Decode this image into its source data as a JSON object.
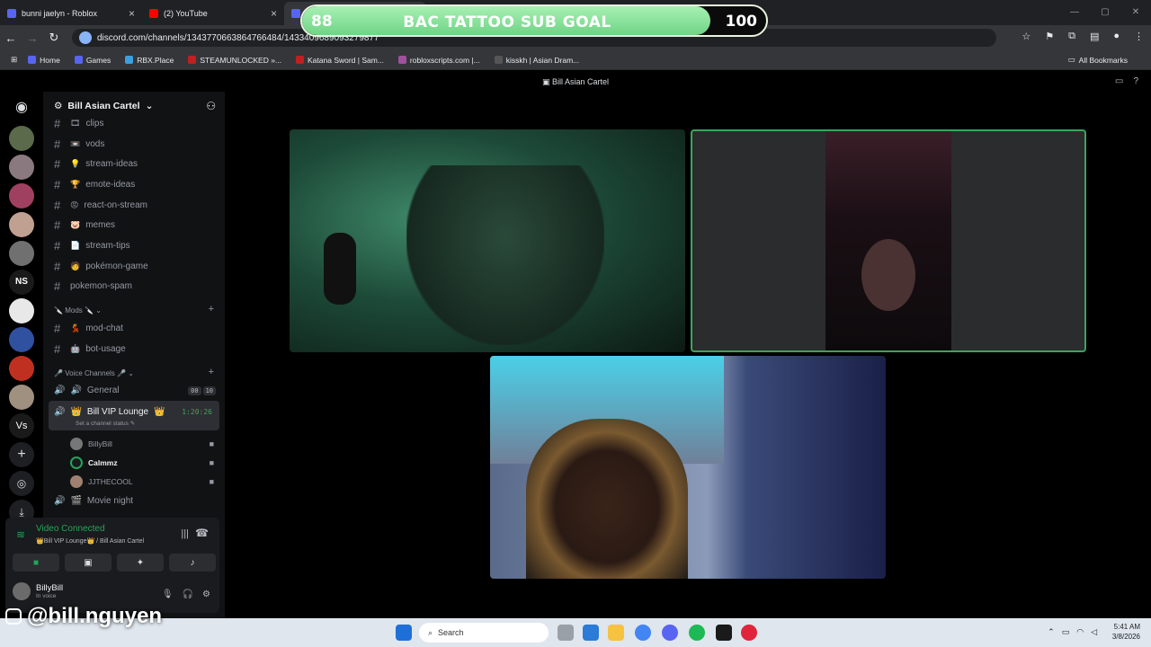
{
  "browser": {
    "tabs": [
      {
        "title": "bunni jaelyn - Roblox",
        "color": "#5865f2"
      },
      {
        "title": "(2) YouTube",
        "color": "#ff0000"
      },
      {
        "title": "",
        "color": "#5865f2"
      }
    ],
    "url": "discord.com/channels/1343770663864766484/1433409689093279877",
    "bookmarks": [
      "Home",
      "Games",
      "RBX.Place",
      "STEAMUNLOCKED »...",
      "Katana Sword | Sam...",
      "robloxscripts.com |...",
      "kisskh | Asian Dram..."
    ],
    "all_bookmarks": "All Bookmarks"
  },
  "overlay": {
    "goal_title": "BAC TATTOO SUB GOAL",
    "current": "88",
    "target": "100",
    "progress_fraction": 0.88,
    "watermark": "@bill.nguyen"
  },
  "discord": {
    "window_title": "Bill Asian Cartel",
    "server_name": "Bill Asian Cartel",
    "channels": [
      {
        "emoji": "🎞",
        "name": "clips"
      },
      {
        "emoji": "📼",
        "name": "vods"
      },
      {
        "emoji": "💡",
        "name": "stream-ideas"
      },
      {
        "emoji": "🏆",
        "name": "emote-ideas"
      },
      {
        "emoji": "😡",
        "name": "react-on-stream"
      },
      {
        "emoji": "🐷",
        "name": "memes"
      },
      {
        "emoji": "📄",
        "name": "stream-tips"
      },
      {
        "emoji": "🧑",
        "name": "pokémon-game"
      },
      {
        "emoji": "",
        "name": "pokemon-spam"
      }
    ],
    "mods_category": "Mods",
    "mod_channels": [
      {
        "emoji": "💃",
        "name": "mod-chat"
      },
      {
        "emoji": "🤖",
        "name": "bot-usage"
      }
    ],
    "voice_category": "Voice Channels",
    "voice": {
      "general": "General",
      "general_badges": [
        "00",
        "10"
      ],
      "lounge": "Bill VIP Lounge",
      "lounge_timer": "1:20:26",
      "lounge_status": "Set a channel status",
      "members": [
        "BillyBill",
        "Calmmz",
        "JJTHECOOL"
      ],
      "movie": "Movie night"
    },
    "panel": {
      "connected": "Video Connected",
      "location": "👑Bill VIP Lounge👑 / Bill Asian Cartel",
      "user": "BillyBill",
      "user_status": "In voice"
    }
  },
  "taskbar": {
    "search": "Search",
    "time": "5:41 AM",
    "date": "3/8/2026"
  }
}
